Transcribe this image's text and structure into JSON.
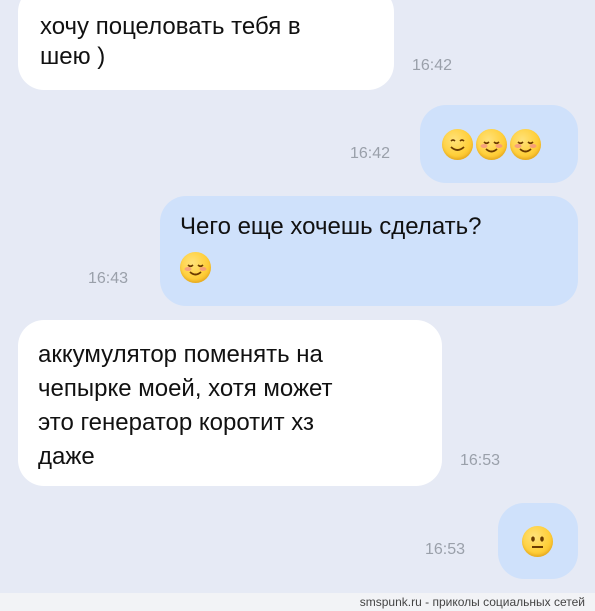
{
  "messages": [
    {
      "direction": "incoming",
      "text": "хочу поцеловать тебя в\nшею )",
      "time": "16:42"
    },
    {
      "direction": "outgoing",
      "emojis": [
        "smiling-face-icon",
        "smiling-blushing-face-icon",
        "smiling-blushing-face-icon"
      ],
      "time": "16:42"
    },
    {
      "direction": "outgoing",
      "text": "Чего еще хочешь сделать?",
      "emojis": [
        "smiling-blushing-face-icon"
      ],
      "time": "16:43"
    },
    {
      "direction": "incoming",
      "text": "аккумулятор поменять на\nчепырке моей, хотя может\nэто генератор коротит хз\nдаже",
      "time": "16:53"
    },
    {
      "direction": "outgoing",
      "emojis": [
        "neutral-face-icon"
      ],
      "time": "16:53"
    }
  ],
  "footer": {
    "watermark": "smspunk.ru - приколы социальных сетей"
  },
  "colors": {
    "background": "#e6eaf5",
    "incoming_bubble": "#ffffff",
    "outgoing_bubble": "#cfe1fb",
    "timestamp": "#9aa0aa"
  }
}
